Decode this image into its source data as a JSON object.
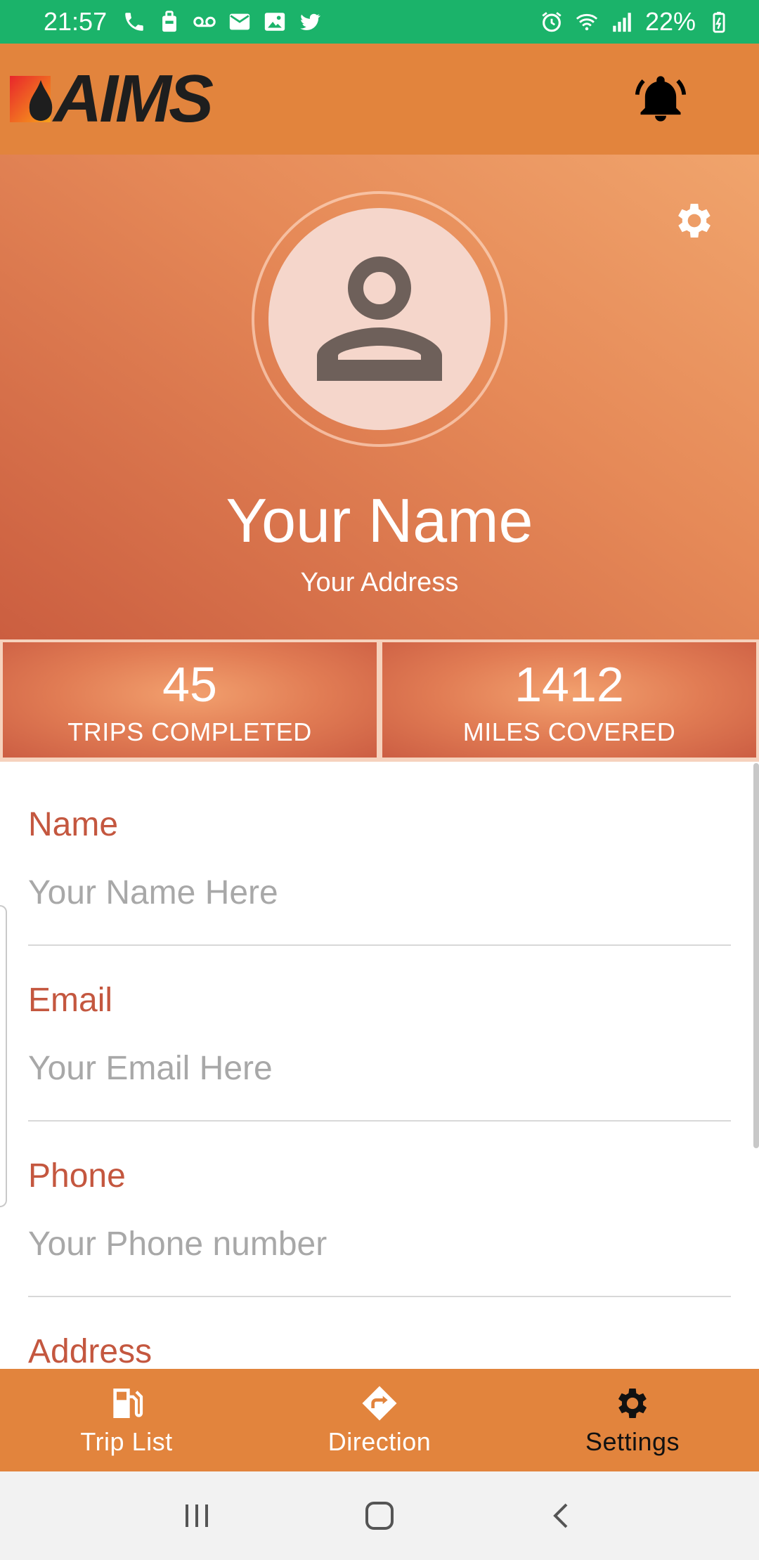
{
  "status_bar": {
    "time": "21:57",
    "battery": "22%"
  },
  "app_bar": {
    "logo_text": "AIMS"
  },
  "profile": {
    "name": "Your Name",
    "address": "Your Address"
  },
  "stats": [
    {
      "value": "45",
      "label": "TRIPS COMPLETED"
    },
    {
      "value": "1412",
      "label": "MILES COVERED"
    }
  ],
  "form": {
    "fields": [
      {
        "label": "Name",
        "placeholder": "Your Name Here"
      },
      {
        "label": "Email",
        "placeholder": "Your Email Here"
      },
      {
        "label": "Phone",
        "placeholder": "Your Phone number"
      },
      {
        "label": "Address",
        "placeholder": ""
      }
    ]
  },
  "bottom_nav": {
    "items": [
      {
        "label": "Trip List",
        "icon": "fuel-pump-icon",
        "active": false
      },
      {
        "label": "Direction",
        "icon": "direction-sign-icon",
        "active": false
      },
      {
        "label": "Settings",
        "icon": "gear-icon",
        "active": true
      }
    ]
  },
  "colors": {
    "status_bar": "#1bb36a",
    "app_bar": "#e2843d",
    "accent": "#c4573f"
  }
}
